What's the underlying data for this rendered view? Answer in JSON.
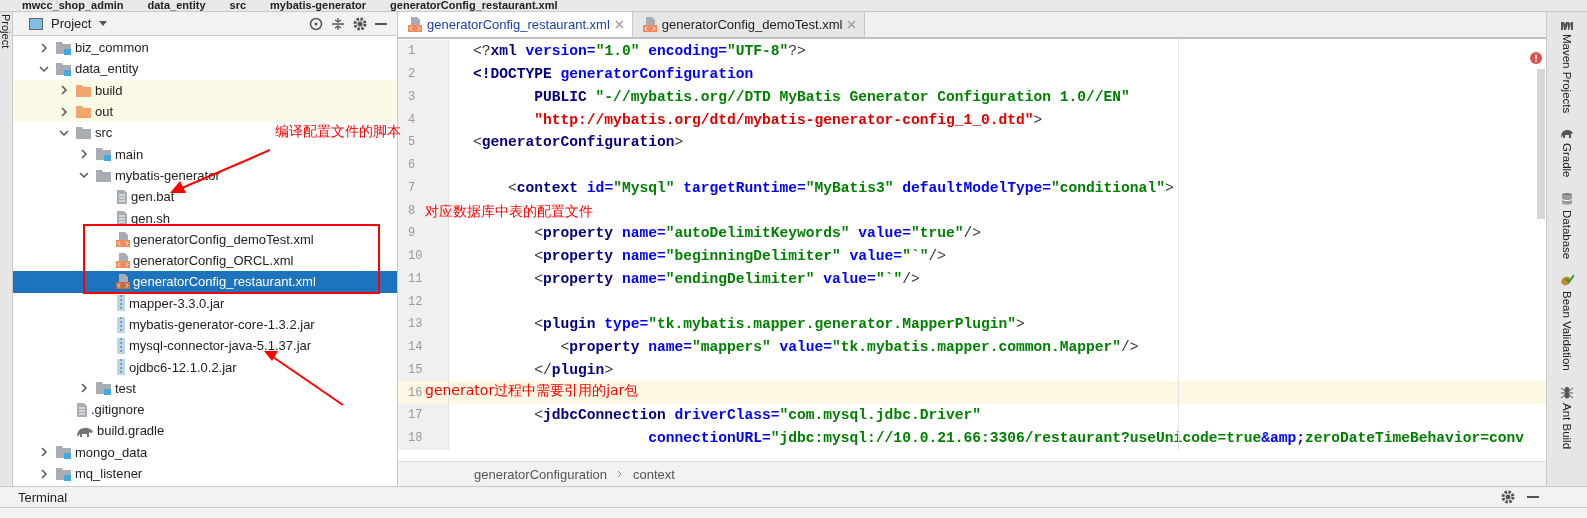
{
  "breadcrumbs": [
    "mwcc_shop_admin",
    "data_entity",
    "src",
    "mybatis-generator",
    "generatorConfig_restaurant.xml"
  ],
  "left_stripe": {
    "label": "Project"
  },
  "project_panel": {
    "title": "Project"
  },
  "project_tree": [
    {
      "name": "biz_common",
      "kind": "module",
      "expanded": false,
      "selected": false
    },
    {
      "name": "data_entity",
      "kind": "module",
      "expanded": true,
      "selected": false,
      "children": [
        {
          "name": "build",
          "kind": "excluded",
          "expanded": false,
          "selected": false
        },
        {
          "name": "out",
          "kind": "excluded",
          "expanded": false,
          "selected": false
        },
        {
          "name": "src",
          "kind": "folder",
          "expanded": true,
          "selected": false,
          "children": [
            {
              "name": "main",
              "kind": "source",
              "expanded": false,
              "selected": false
            },
            {
              "name": "mybatis-generator",
              "kind": "folder",
              "expanded": true,
              "selected": false,
              "children": [
                {
                  "name": "gen.bat",
                  "kind": "text",
                  "selected": false
                },
                {
                  "name": "gen.sh",
                  "kind": "text",
                  "selected": false
                },
                {
                  "name": "generatorConfig_demoTest.xml",
                  "kind": "xml",
                  "selected": false
                },
                {
                  "name": "generatorConfig_ORCL.xml",
                  "kind": "xml",
                  "selected": false
                },
                {
                  "name": "generatorConfig_restaurant.xml",
                  "kind": "xml",
                  "selected": true
                },
                {
                  "name": "mapper-3.3.0.jar",
                  "kind": "jar",
                  "selected": false
                },
                {
                  "name": "mybatis-generator-core-1.3.2.jar",
                  "kind": "jar",
                  "selected": false
                },
                {
                  "name": "mysql-connector-java-5.1.37.jar",
                  "kind": "jar",
                  "selected": false
                },
                {
                  "name": "ojdbc6-12.1.0.2.jar",
                  "kind": "jar",
                  "selected": false
                }
              ]
            },
            {
              "name": "test",
              "kind": "source",
              "expanded": false,
              "selected": false
            }
          ]
        },
        {
          "name": ".gitignore",
          "kind": "text",
          "selected": false
        },
        {
          "name": "build.gradle",
          "kind": "gradle",
          "selected": false
        }
      ]
    },
    {
      "name": "mongo_data",
      "kind": "module",
      "expanded": false,
      "selected": false
    },
    {
      "name": "mq_listener",
      "kind": "module",
      "expanded": false,
      "selected": false
    }
  ],
  "editor_tabs": [
    {
      "label": "generatorConfig_restaurant.xml",
      "selected": true
    },
    {
      "label": "generatorConfig_demoTest.xml",
      "selected": false
    }
  ],
  "code_lines": [
    {
      "number": "1",
      "current": false,
      "tokens": [
        {
          "kind": "bracket",
          "text": "<?"
        },
        {
          "kind": "tag",
          "text": "xml"
        },
        {
          "kind": "attr",
          "text": " version="
        },
        {
          "kind": "value",
          "text": "\"1.0\""
        },
        {
          "kind": "attr",
          "text": " encoding="
        },
        {
          "kind": "value",
          "text": "\"UTF-8\""
        },
        {
          "kind": "bracket",
          "text": "?>"
        }
      ]
    },
    {
      "number": "2",
      "current": false,
      "tokens": [
        {
          "kind": "tag",
          "text": "<!DOCTYPE "
        },
        {
          "kind": "attr",
          "text": "generatorConfiguration"
        }
      ]
    },
    {
      "number": "3",
      "current": false,
      "tokens": [
        {
          "kind": "tag",
          "text": "       PUBLIC "
        },
        {
          "kind": "value",
          "text": "\"-//mybatis.org//DTD MyBatis Generator Configuration 1.0//EN\""
        }
      ]
    },
    {
      "number": "4",
      "current": false,
      "tokens": [
        {
          "kind": "url",
          "text": "       \"http://mybatis.org/dtd/mybatis-generator-config_1_0.dtd\""
        },
        {
          "kind": "bracket",
          "text": ">"
        }
      ]
    },
    {
      "number": "5",
      "current": false,
      "tokens": [
        {
          "kind": "bracket",
          "text": "<"
        },
        {
          "kind": "tag",
          "text": "generatorConfiguration"
        },
        {
          "kind": "bracket",
          "text": ">"
        }
      ]
    },
    {
      "number": "6",
      "current": false
    },
    {
      "number": "7",
      "current": false,
      "tokens": [
        {
          "kind": "bracket",
          "text": "    <"
        },
        {
          "kind": "tag",
          "text": "context"
        },
        {
          "kind": "attr",
          "text": " id="
        },
        {
          "kind": "value",
          "text": "\"Mysql\""
        },
        {
          "kind": "attr",
          "text": " targetRuntime="
        },
        {
          "kind": "value",
          "text": "\"MyBatis3\""
        },
        {
          "kind": "attr",
          "text": " defaultModelType="
        },
        {
          "kind": "value",
          "text": "\"conditional\""
        },
        {
          "kind": "bracket",
          "text": ">"
        }
      ]
    },
    {
      "number": "8",
      "current": false
    },
    {
      "number": "9",
      "current": false,
      "tokens": [
        {
          "kind": "bracket",
          "text": "       <"
        },
        {
          "kind": "tag",
          "text": "property"
        },
        {
          "kind": "attr",
          "text": " name="
        },
        {
          "kind": "value",
          "text": "\"autoDelimitKeywords\""
        },
        {
          "kind": "attr",
          "text": " value="
        },
        {
          "kind": "value",
          "text": "\"true\""
        },
        {
          "kind": "bracket",
          "text": "/>"
        }
      ]
    },
    {
      "number": "10",
      "current": false,
      "tokens": [
        {
          "kind": "bracket",
          "text": "       <"
        },
        {
          "kind": "tag",
          "text": "property"
        },
        {
          "kind": "attr",
          "text": " name="
        },
        {
          "kind": "value",
          "text": "\"beginningDelimiter\""
        },
        {
          "kind": "attr",
          "text": " value="
        },
        {
          "kind": "value",
          "text": "\"`\""
        },
        {
          "kind": "bracket",
          "text": "/>"
        }
      ]
    },
    {
      "number": "11",
      "current": false,
      "tokens": [
        {
          "kind": "bracket",
          "text": "       <"
        },
        {
          "kind": "tag",
          "text": "property"
        },
        {
          "kind": "attr",
          "text": " name="
        },
        {
          "kind": "value",
          "text": "\"endingDelimiter\""
        },
        {
          "kind": "attr",
          "text": " value="
        },
        {
          "kind": "value",
          "text": "\"`\""
        },
        {
          "kind": "bracket",
          "text": "/>"
        }
      ]
    },
    {
      "number": "12",
      "current": false
    },
    {
      "number": "13",
      "current": false,
      "tokens": [
        {
          "kind": "bracket",
          "text": "       <"
        },
        {
          "kind": "tag",
          "text": "plugin"
        },
        {
          "kind": "attr",
          "text": " type="
        },
        {
          "kind": "value",
          "text": "\"tk.mybatis.mapper.generator.MapperPlugin\""
        },
        {
          "kind": "bracket",
          "text": ">"
        }
      ]
    },
    {
      "number": "14",
      "current": false,
      "tokens": [
        {
          "kind": "bracket",
          "text": "          <"
        },
        {
          "kind": "tag",
          "text": "property"
        },
        {
          "kind": "attr",
          "text": " name="
        },
        {
          "kind": "value",
          "text": "\"mappers\""
        },
        {
          "kind": "attr",
          "text": " value="
        },
        {
          "kind": "value",
          "text": "\"tk.mybatis.mapper.common.Mapper\""
        },
        {
          "kind": "bracket",
          "text": "/>"
        }
      ]
    },
    {
      "number": "15",
      "current": false,
      "tokens": [
        {
          "kind": "bracket",
          "text": "       </"
        },
        {
          "kind": "tag",
          "text": "plugin"
        },
        {
          "kind": "bracket",
          "text": ">"
        }
      ]
    },
    {
      "number": "16",
      "current": true
    },
    {
      "number": "17",
      "current": false,
      "tokens": [
        {
          "kind": "bracket",
          "text": "       <"
        },
        {
          "kind": "tag",
          "text": "jdbcConnection"
        },
        {
          "kind": "attr",
          "text": " driverClass="
        },
        {
          "kind": "value",
          "text": "\"com.mysql.jdbc.Driver\""
        }
      ]
    },
    {
      "number": "18",
      "current": false,
      "tokens": [
        {
          "kind": "attr",
          "text": "                    connectionURL="
        },
        {
          "kind": "value",
          "text": "\"jdbc:mysql://10.0.21.66:3306/restaurant?useUnicode=true"
        },
        {
          "kind": "entity",
          "text": "&amp;"
        },
        {
          "kind": "value",
          "text": "zeroDateTimeBehavior=conv"
        }
      ]
    }
  ],
  "editor_breadcrumbs": [
    "generatorConfiguration",
    "context"
  ],
  "right_stripe": [
    {
      "label": "Maven Projects",
      "kind": "maven"
    },
    {
      "label": "Gradle",
      "kind": "gradle"
    },
    {
      "label": "Database",
      "kind": "database"
    },
    {
      "label": "Bean Validation",
      "kind": "bean"
    },
    {
      "label": "Ant Build",
      "kind": "ant"
    }
  ],
  "bottom_panel": {
    "title": "Terminal"
  },
  "annotations": [
    "编译配置文件的脚本",
    "对应数据库中表的配置文件",
    "generator过程中需要引用的jar包"
  ]
}
